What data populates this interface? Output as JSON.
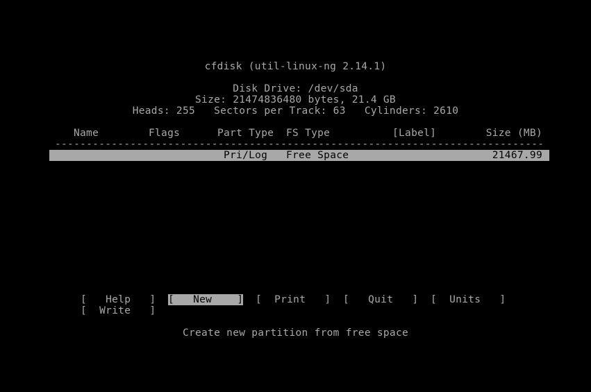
{
  "title": "cfdisk (util-linux-ng 2.14.1)",
  "disk": {
    "drive": "Disk Drive: /dev/sda",
    "size": "Size: 21474836480 bytes, 21.4 GB",
    "geometry": "Heads: 255   Sectors per Track: 63   Cylinders: 2610"
  },
  "table": {
    "headers": {
      "name": "Name",
      "flags": "Flags",
      "part_type": "Part Type",
      "fs_type": "FS Type",
      "label": "[Label]",
      "size": "Size (MB)"
    },
    "divider": "------------------------------------------------------------------------------------------------------------------------",
    "rows": [
      {
        "name": "",
        "flags": "",
        "part_type": "Pri/Log",
        "fs_type": "Free Space",
        "label": "",
        "size": "21467.99",
        "selected": true
      }
    ]
  },
  "menu": {
    "items": [
      {
        "label": "[   Help   ]",
        "selected": false
      },
      {
        "label": "[   New    ]",
        "selected": true
      },
      {
        "label": "[  Print   ]",
        "selected": false
      },
      {
        "label": "[   Quit   ]",
        "selected": false
      },
      {
        "label": "[  Units   ]",
        "selected": false
      },
      {
        "label": "[  Write   ]",
        "selected": false
      }
    ]
  },
  "status": "Create new partition from free space"
}
